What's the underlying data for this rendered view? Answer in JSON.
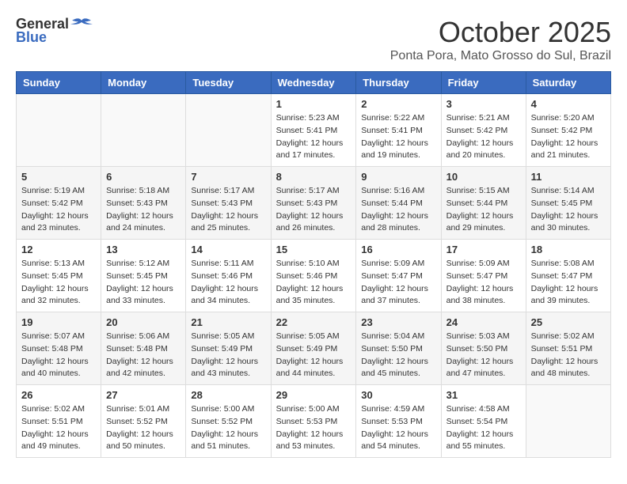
{
  "header": {
    "logo_general": "General",
    "logo_blue": "Blue",
    "month": "October 2025",
    "location": "Ponta Pora, Mato Grosso do Sul, Brazil"
  },
  "weekdays": [
    "Sunday",
    "Monday",
    "Tuesday",
    "Wednesday",
    "Thursday",
    "Friday",
    "Saturday"
  ],
  "weeks": [
    [
      {
        "day": "",
        "info": ""
      },
      {
        "day": "",
        "info": ""
      },
      {
        "day": "",
        "info": ""
      },
      {
        "day": "1",
        "info": "Sunrise: 5:23 AM\nSunset: 5:41 PM\nDaylight: 12 hours and 17 minutes."
      },
      {
        "day": "2",
        "info": "Sunrise: 5:22 AM\nSunset: 5:41 PM\nDaylight: 12 hours and 19 minutes."
      },
      {
        "day": "3",
        "info": "Sunrise: 5:21 AM\nSunset: 5:42 PM\nDaylight: 12 hours and 20 minutes."
      },
      {
        "day": "4",
        "info": "Sunrise: 5:20 AM\nSunset: 5:42 PM\nDaylight: 12 hours and 21 minutes."
      }
    ],
    [
      {
        "day": "5",
        "info": "Sunrise: 5:19 AM\nSunset: 5:42 PM\nDaylight: 12 hours and 23 minutes."
      },
      {
        "day": "6",
        "info": "Sunrise: 5:18 AM\nSunset: 5:43 PM\nDaylight: 12 hours and 24 minutes."
      },
      {
        "day": "7",
        "info": "Sunrise: 5:17 AM\nSunset: 5:43 PM\nDaylight: 12 hours and 25 minutes."
      },
      {
        "day": "8",
        "info": "Sunrise: 5:17 AM\nSunset: 5:43 PM\nDaylight: 12 hours and 26 minutes."
      },
      {
        "day": "9",
        "info": "Sunrise: 5:16 AM\nSunset: 5:44 PM\nDaylight: 12 hours and 28 minutes."
      },
      {
        "day": "10",
        "info": "Sunrise: 5:15 AM\nSunset: 5:44 PM\nDaylight: 12 hours and 29 minutes."
      },
      {
        "day": "11",
        "info": "Sunrise: 5:14 AM\nSunset: 5:45 PM\nDaylight: 12 hours and 30 minutes."
      }
    ],
    [
      {
        "day": "12",
        "info": "Sunrise: 5:13 AM\nSunset: 5:45 PM\nDaylight: 12 hours and 32 minutes."
      },
      {
        "day": "13",
        "info": "Sunrise: 5:12 AM\nSunset: 5:45 PM\nDaylight: 12 hours and 33 minutes."
      },
      {
        "day": "14",
        "info": "Sunrise: 5:11 AM\nSunset: 5:46 PM\nDaylight: 12 hours and 34 minutes."
      },
      {
        "day": "15",
        "info": "Sunrise: 5:10 AM\nSunset: 5:46 PM\nDaylight: 12 hours and 35 minutes."
      },
      {
        "day": "16",
        "info": "Sunrise: 5:09 AM\nSunset: 5:47 PM\nDaylight: 12 hours and 37 minutes."
      },
      {
        "day": "17",
        "info": "Sunrise: 5:09 AM\nSunset: 5:47 PM\nDaylight: 12 hours and 38 minutes."
      },
      {
        "day": "18",
        "info": "Sunrise: 5:08 AM\nSunset: 5:47 PM\nDaylight: 12 hours and 39 minutes."
      }
    ],
    [
      {
        "day": "19",
        "info": "Sunrise: 5:07 AM\nSunset: 5:48 PM\nDaylight: 12 hours and 40 minutes."
      },
      {
        "day": "20",
        "info": "Sunrise: 5:06 AM\nSunset: 5:48 PM\nDaylight: 12 hours and 42 minutes."
      },
      {
        "day": "21",
        "info": "Sunrise: 5:05 AM\nSunset: 5:49 PM\nDaylight: 12 hours and 43 minutes."
      },
      {
        "day": "22",
        "info": "Sunrise: 5:05 AM\nSunset: 5:49 PM\nDaylight: 12 hours and 44 minutes."
      },
      {
        "day": "23",
        "info": "Sunrise: 5:04 AM\nSunset: 5:50 PM\nDaylight: 12 hours and 45 minutes."
      },
      {
        "day": "24",
        "info": "Sunrise: 5:03 AM\nSunset: 5:50 PM\nDaylight: 12 hours and 47 minutes."
      },
      {
        "day": "25",
        "info": "Sunrise: 5:02 AM\nSunset: 5:51 PM\nDaylight: 12 hours and 48 minutes."
      }
    ],
    [
      {
        "day": "26",
        "info": "Sunrise: 5:02 AM\nSunset: 5:51 PM\nDaylight: 12 hours and 49 minutes."
      },
      {
        "day": "27",
        "info": "Sunrise: 5:01 AM\nSunset: 5:52 PM\nDaylight: 12 hours and 50 minutes."
      },
      {
        "day": "28",
        "info": "Sunrise: 5:00 AM\nSunset: 5:52 PM\nDaylight: 12 hours and 51 minutes."
      },
      {
        "day": "29",
        "info": "Sunrise: 5:00 AM\nSunset: 5:53 PM\nDaylight: 12 hours and 53 minutes."
      },
      {
        "day": "30",
        "info": "Sunrise: 4:59 AM\nSunset: 5:53 PM\nDaylight: 12 hours and 54 minutes."
      },
      {
        "day": "31",
        "info": "Sunrise: 4:58 AM\nSunset: 5:54 PM\nDaylight: 12 hours and 55 minutes."
      },
      {
        "day": "",
        "info": ""
      }
    ]
  ]
}
